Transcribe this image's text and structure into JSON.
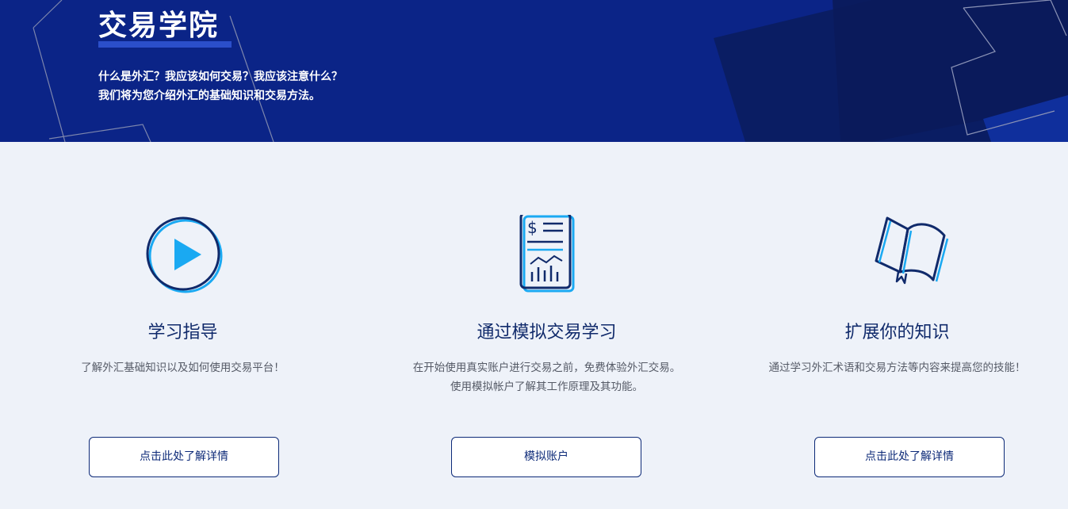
{
  "hero": {
    "title": "交易学院",
    "line1": "什么是外汇？我应该如何交易？我应该注意什么？",
    "line2": "我们将为您介绍外汇的基础知识和交易方法。"
  },
  "cards": [
    {
      "icon": "play-icon",
      "title": "学习指导",
      "desc_line1": "了解外汇基础知识以及如何使用交易平台！",
      "desc_line2": "",
      "button": "点击此处了解详情"
    },
    {
      "icon": "report-document-icon",
      "title": "通过模拟交易学习",
      "desc_line1": "在开始使用真实账户进行交易之前，免费体验外汇交易。",
      "desc_line2": "使用模拟帐户了解其工作原理及其功能。",
      "button": "模拟账户"
    },
    {
      "icon": "open-book-icon",
      "title": "扩展你的知识",
      "desc_line1": "通过学习外汇术语和交易方法等内容来提高您的技能！",
      "desc_line2": "",
      "button": "点击此处了解详情"
    }
  ],
  "colors": {
    "hero_bg": "#0b2487",
    "page_bg": "#eef2f9",
    "accent": "#1aa9f2",
    "navy": "#0d2a78"
  }
}
